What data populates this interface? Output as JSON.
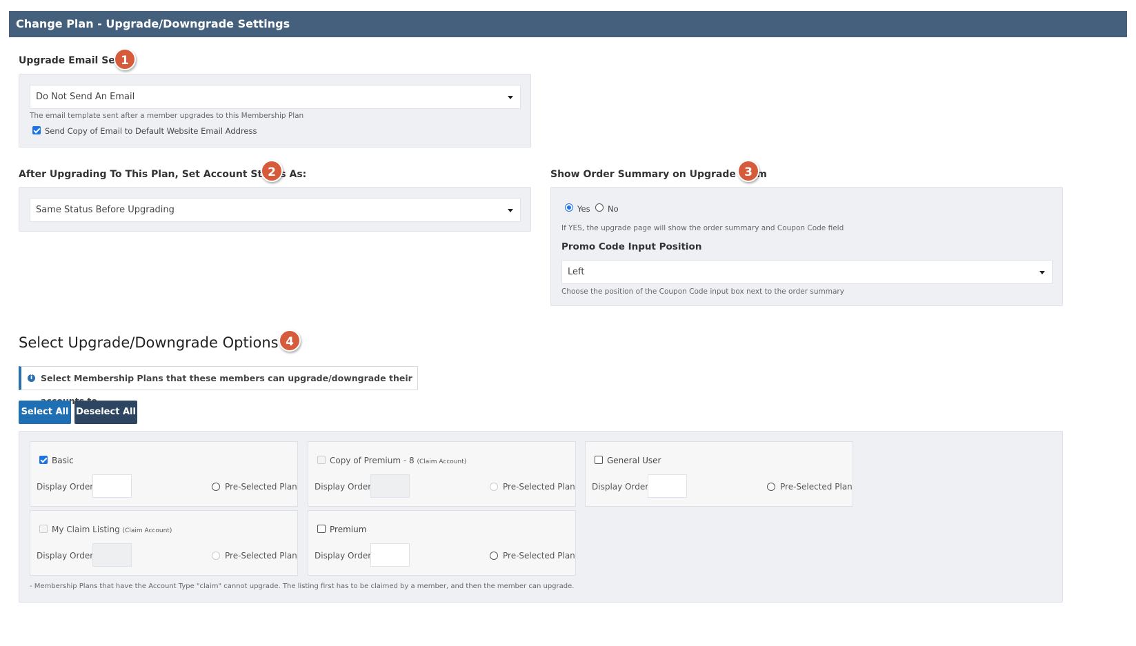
{
  "header": {
    "title": "Change Plan - Upgrade/Downgrade Settings"
  },
  "section1": {
    "label": "Upgrade Email Sent",
    "badge": "1",
    "select_value": "Do Not Send An Email",
    "help": "The email template sent after a member upgrades to this Membership Plan",
    "checkbox_label": "Send Copy of Email to Default Website Email Address",
    "checkbox_checked": true
  },
  "section2": {
    "label": "After Upgrading To This Plan, Set Account Status As:",
    "badge": "2",
    "select_value": "Same Status Before Upgrading"
  },
  "section3": {
    "label": "Show Order Summary on Upgrade Form",
    "badge": "3",
    "radio_yes": "Yes",
    "radio_no": "No",
    "selected": "Yes",
    "help": "If YES, the upgrade page will show the order summary and Coupon Code field",
    "promo_label": "Promo Code Input Position",
    "promo_value": "Left",
    "promo_help": "Choose the position of the Coupon Code input box next to the order summary"
  },
  "section4": {
    "title": "Select Upgrade/Downgrade Options",
    "badge": "4",
    "info": "Select Membership Plans that these members can upgrade/downgrade their accounts to.",
    "select_all": "Select All",
    "deselect_all": "Deselect All",
    "display_order_label": "Display Order",
    "preselected_label": "Pre-Selected Plan",
    "plans": [
      {
        "name": "Basic",
        "tag": "",
        "checked": true,
        "disabled": false
      },
      {
        "name": "Copy of Premium - 8",
        "tag": "(Claim Account)",
        "checked": false,
        "disabled": true
      },
      {
        "name": "General User",
        "tag": "",
        "checked": false,
        "disabled": false
      },
      {
        "name": "My Claim Listing",
        "tag": "(Claim Account)",
        "checked": false,
        "disabled": true
      },
      {
        "name": "Premium",
        "tag": "",
        "checked": false,
        "disabled": false
      }
    ],
    "footnote": "- Membership Plans that have the Account Type \"claim\" cannot upgrade. The listing first has to be claimed by a member, and then the member can upgrade."
  },
  "colors": {
    "header_bg": "#44607d",
    "badge": "#d65b3b",
    "select_all_btn": "#1f6fb5",
    "deselect_all_btn": "#2d4560",
    "accent": "#1a73e8"
  }
}
